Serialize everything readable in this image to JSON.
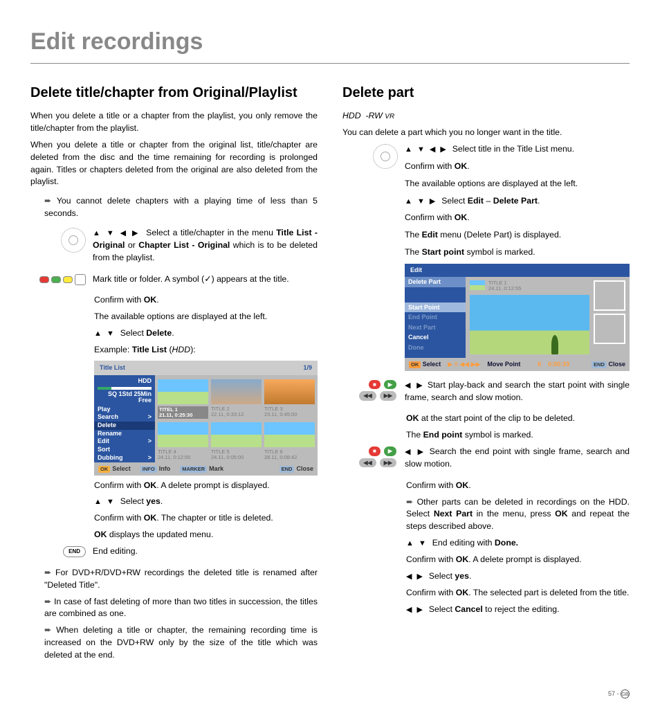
{
  "page": {
    "title": "Edit recordings",
    "footer_num": "57 -",
    "footer_region": "GB"
  },
  "left": {
    "h2": "Delete title/chapter from Original/Playlist",
    "p1": "When you delete a title or a chapter from the playlist, you only remove the title/chapter from the playlist.",
    "p2": "When you delete a title or chapter from the original list, title/chapter are deleted from the disc and the time remaining for recording is prolonged again. Titles or chapters deleted from the original are also deleted from the playlist.",
    "note1": "You cannot delete chapters with a playing time of less than 5 seconds.",
    "r1a_pre": "Select a title/chapter in the menu ",
    "r1a_b1": "Title List - Original",
    "r1a_mid": " or ",
    "r1a_b2": "Chapter List - Original",
    "r1a_post": " which is to be deleted from the playlist.",
    "r2": "Mark title or folder. A symbol (✓) appears at the title.",
    "r3": "Confirm with ",
    "ok": "OK",
    "r3b": ".",
    "r4": "The available options are displayed at the left.",
    "r5a": "Select ",
    "r5b": "Delete",
    "r5c": ".",
    "r6a": "Example: ",
    "r6b": "Title List",
    "r6c": " (",
    "r6d": "HDD",
    "r6e": "):",
    "r7a": "Confirm with ",
    "r7b": ". A delete prompt is displayed.",
    "r8a": "Select ",
    "r8b": "yes",
    "r8c": ".",
    "r9a": "Confirm with ",
    "r9b": ". The chapter or title is deleted.",
    "r10a": "OK",
    "r10b": " displays the updated menu.",
    "r11": "End editing.",
    "n2": "For DVD+R/DVD+RW recordings the deleted title is renamed after \"Deleted Title\".",
    "n3": "In case of fast deleting of more than two titles in succession, the titles are combined as one.",
    "n4": "When deleting a title or chapter, the remaining recording time is increased on the DVD+RW only by the size of the title which was deleted at the end."
  },
  "shot1": {
    "title": "Title List",
    "count": "1/9",
    "hdd": "HDD",
    "sq": "SQ   1Std 25Min",
    "free": "Free",
    "menu": [
      "Play",
      "Search",
      "Delete",
      "Rename",
      "Edit",
      "Sort",
      "Dubbing"
    ],
    "sel": "Delete",
    "thumbs": [
      {
        "t": "TITEL 1",
        "s": "21.11,  0:25:30",
        "sel": true
      },
      {
        "t": "TITLE 2",
        "s": "22.11,  0:33:12"
      },
      {
        "t": "TITLE 3",
        "s": "23.11,  0:45:00"
      },
      {
        "t": "TITLE 4",
        "s": "24.11,  0:12:55"
      },
      {
        "t": "TITLE 5",
        "s": "24.11,  0:05:00"
      },
      {
        "t": "TITLE 6",
        "s": "28.11,  0:08:42"
      }
    ],
    "f_ok": "OK",
    "f_sel": "Select",
    "f_info_t": "INFO",
    "f_info": "Info",
    "f_mark_t": "MARKER",
    "f_mark": "Mark",
    "f_end_t": "END",
    "f_close": "Close"
  },
  "right": {
    "h2": "Delete part",
    "sub_a": "HDD",
    "sub_b": "-RW",
    "sub_c": "VR",
    "p1": "You can delete a part which you no longer want in the title.",
    "r1": "Select title in the Title List menu.",
    "r2a": "Confirm with ",
    "r2b": "OK",
    "r2c": ".",
    "r3": "The available options are displayed at the left.",
    "r4a": "Select ",
    "r4b": "Edit",
    "r4c": " – ",
    "r4d": "Delete Part",
    "r4e": ".",
    "r5a": "Confirm with ",
    "r5b": ".",
    "r6a": "The ",
    "r6b": "Edit",
    "r6c": " menu (Delete Part) is displayed.",
    "r7a": "The ",
    "r7b": "Start point",
    "r7c": " symbol is marked.",
    "r8": "Start play-back and search the start point with single frame, search and slow motion.",
    "r9a": "OK",
    "r9b": " at the start point of the clip to be deleted.",
    "r10a": "The ",
    "r10b": "End point",
    "r10c": " symbol is marked.",
    "r11": "Search the end point with single frame, search and slow motion.",
    "r12a": "Confirm with ",
    "r12b": ".",
    "r13a": "Other parts can be deleted in recordings on the HDD. Select ",
    "r13b": "Next Part",
    "r13c": " in the menu, press ",
    "r13d": "OK",
    "r13e": " and repeat the steps described above.",
    "r14a": "End editing with ",
    "r14b": "Done.",
    "r15a": "Confirm with ",
    "r15b": ". A delete prompt is displayed.",
    "r16a": "Select ",
    "r16b": "yes",
    "r16c": ".",
    "r17a": "Confirm with ",
    "r17b": ". The selected part is deleted from the title.",
    "r18a": "Select ",
    "r18b": "Cancel",
    "r18c": " to reject the editing."
  },
  "shot2": {
    "hdr": "Edit",
    "menu": [
      "Delete Part"
    ],
    "lines": [
      "Start Point",
      "End Point",
      "Next Part",
      "Cancel",
      "Done"
    ],
    "sel": "Start Point",
    "dim": [
      "End Point",
      "Next Part",
      "Done"
    ],
    "minit": "TITLE 1",
    "minis": "24.11,  0:12:55",
    "f_ok": "OK",
    "f_sel": "Select",
    "f_sym": "▶ II ◀◀ ▶▶",
    "f_mp": "Move Point",
    "f_time": "0:00:33",
    "f_end_t": "END",
    "f_close": "Close"
  },
  "sym": {
    "udlr": "▲ ▼ ◀ ▶",
    "ud": "▲ ▼",
    "lr": "◀ ▶",
    "udr": "▲ ▼ ▶",
    "end": "END",
    "pause": "II"
  }
}
